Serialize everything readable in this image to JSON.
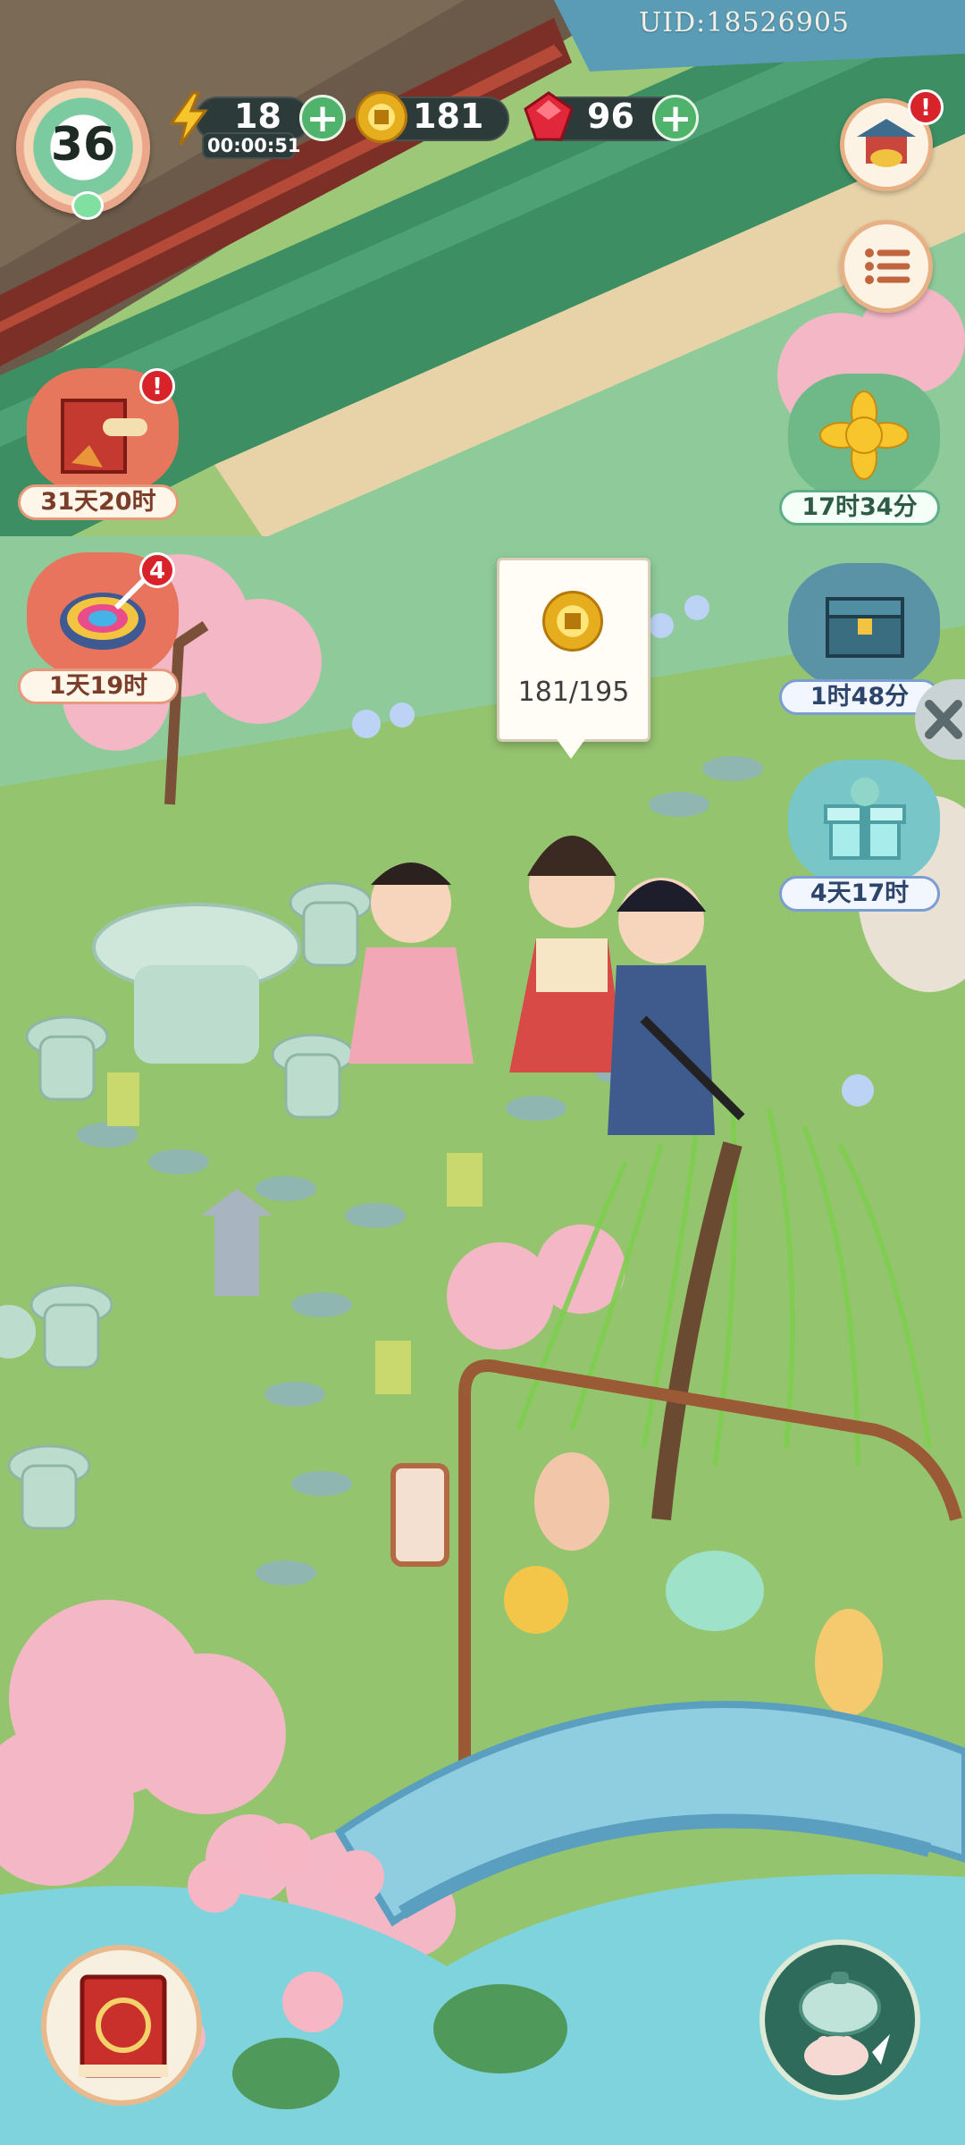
{
  "hud": {
    "uid": "UID:18526905",
    "level": "36",
    "energy": {
      "value": "18",
      "timer": "00:00:51",
      "icon": "lightning-icon"
    },
    "coins": {
      "value": "181",
      "icon": "coin-icon"
    },
    "gems": {
      "value": "96",
      "icon": "ruby-icon"
    },
    "plus_symbol": "+",
    "shop_badge": "!",
    "menu_icon": "list-menu-icon"
  },
  "events_left": [
    {
      "name": "book-event",
      "label": "31天20时",
      "badge": "!"
    },
    {
      "name": "paint-event",
      "label": "1天19时",
      "badge": "4"
    }
  ],
  "events_right": [
    {
      "name": "chrysanthemum-event",
      "label": "17时34分"
    },
    {
      "name": "chest-event",
      "label": "1时48分"
    },
    {
      "name": "gift-event",
      "label": "4天17时"
    }
  ],
  "tooltip": {
    "value": "181/195",
    "icon": "coin-icon"
  },
  "bottom": {
    "left_button_icon": "book-icon",
    "right_button_icon": "teapot-icon"
  }
}
